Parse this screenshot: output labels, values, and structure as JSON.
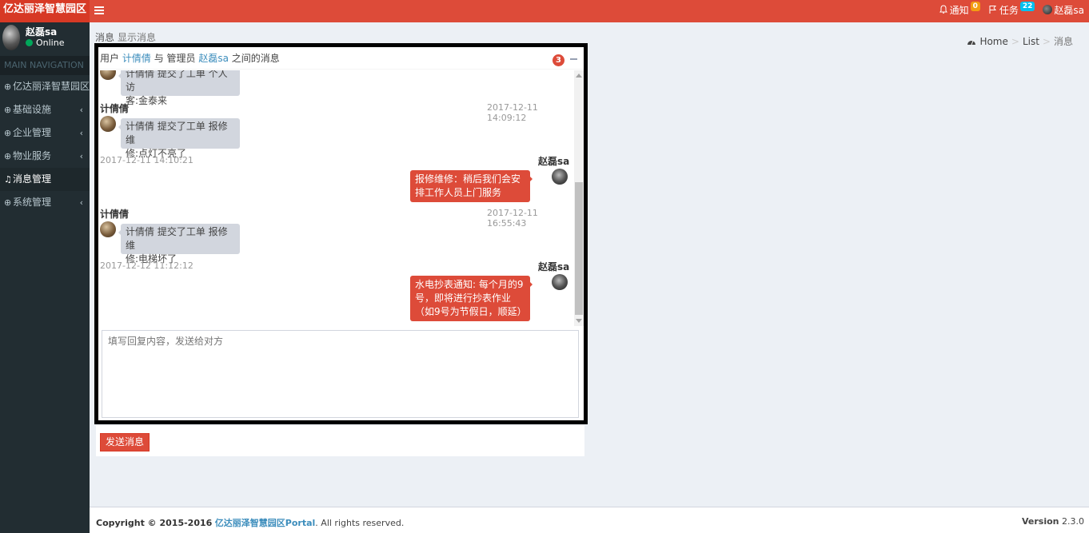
{
  "app": {
    "logo_text": "亿达丽泽智慧园区"
  },
  "topnav": {
    "notify_label": "通知",
    "notify_count": "0",
    "task_label": "任务",
    "task_count": "22",
    "user_name": "赵磊sa"
  },
  "sidebar": {
    "user_name": "赵磊sa",
    "status": "Online",
    "header": "MAIN NAVIGATION",
    "items": [
      {
        "label": "亿达丽泽智慧园区",
        "has_children": false,
        "active": false
      },
      {
        "label": "基础设施",
        "has_children": true,
        "active": false
      },
      {
        "label": "企业管理",
        "has_children": true,
        "active": false
      },
      {
        "label": "物业服务",
        "has_children": true,
        "active": false
      },
      {
        "label": "消息管理",
        "has_children": false,
        "active": true
      },
      {
        "label": "系统管理",
        "has_children": true,
        "active": false
      }
    ]
  },
  "breadcrumb": {
    "title": "消息",
    "subtitle": "显示消息",
    "home": "Home",
    "list": "List",
    "current": "消息"
  },
  "chat": {
    "header_prefix": "用户",
    "user": "计倩倩",
    "header_mid": "与 管理员",
    "admin": "赵磊sa",
    "header_suffix": "之间的消息",
    "count": "3",
    "messages": [
      {
        "side": "left",
        "name": "",
        "time": "",
        "lines": [
          "计倩倩 提交了工单 个人访",
          "客:金泰来"
        ]
      },
      {
        "side": "left",
        "name": "计倩倩",
        "time": "2017-12-11 14:09:12",
        "lines": [
          "计倩倩 提交了工单 报修维",
          "修:点灯不亮了"
        ]
      },
      {
        "side": "right",
        "name": "赵磊sa",
        "time": "2017-12-11 14:10:21",
        "lines": [
          "报修维修：稍后我们会安",
          "排工作人员上门服务"
        ]
      },
      {
        "side": "left",
        "name": "计倩倩",
        "time": "2017-12-11 16:55:43",
        "lines": [
          "计倩倩 提交了工单 报修维",
          "修:电梯坏了"
        ]
      },
      {
        "side": "right",
        "name": "赵磊sa",
        "time": "2017-12-12 11:12:12",
        "lines": [
          "水电抄表通知: 每个月的9",
          "号，即将进行抄表作业",
          "（如9号为节假日，顺延）"
        ]
      }
    ],
    "reply_placeholder": "填写回复内容，发送给对方",
    "send_label": "发送消息"
  },
  "footer": {
    "copyright": "Copyright © 2015-2016",
    "brand": "亿达丽泽智慧园区Portal",
    "rights": ". All rights reserved.",
    "version_label": "Version",
    "version": "2.3.0"
  },
  "colors": {
    "header": "#dd4b39",
    "logo": "#d73925",
    "sidebar": "#222d32",
    "link": "#3c8dbc"
  }
}
